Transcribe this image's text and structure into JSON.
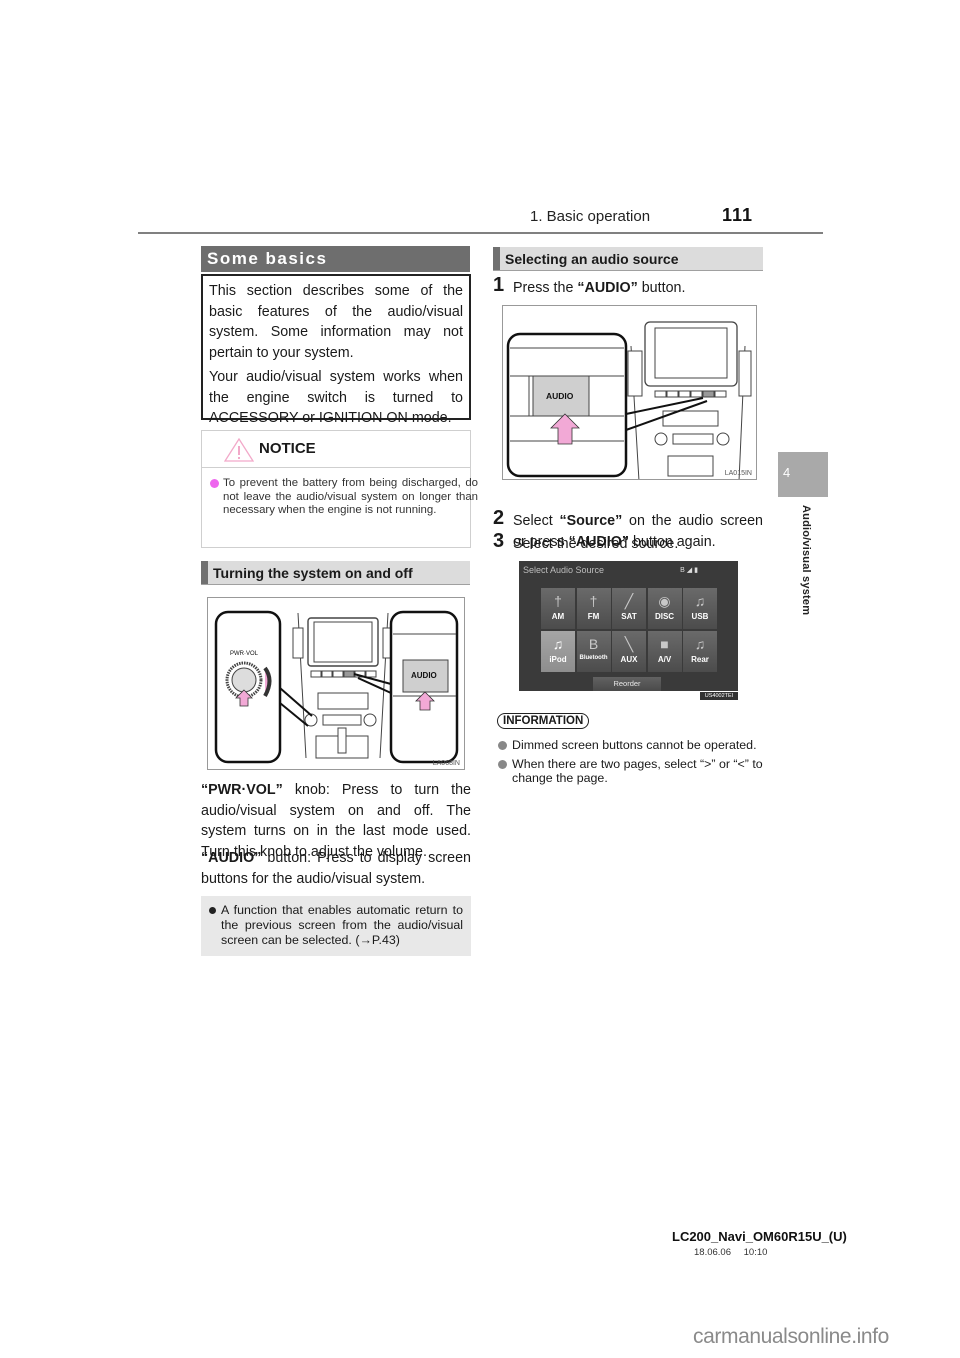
{
  "header": {
    "section": "1. Basic operation",
    "page_number": "111"
  },
  "side_tab": {
    "chapter_number": "4",
    "chapter_title": "Audio/visual system"
  },
  "some_basics": {
    "title": "Some basics",
    "paragraphs": [
      "This section describes some of the basic features of the audio/visual system. Some information may not pertain to your system.",
      "Your audio/visual system works when the engine switch is turned to ACCESSORY or IGNITION ON mode."
    ]
  },
  "notice": {
    "icon": "warning-triangle-icon",
    "title": "NOTICE",
    "items": [
      "To prevent the battery from being discharged, do not leave the audio/visual system on longer than necessary when the engine is not running."
    ]
  },
  "turning_on_off": {
    "title": "Turning the system on and off",
    "figure": {
      "knob_label": "PWR·VOL",
      "button_label": "AUDIO",
      "code": "LA068IN"
    },
    "pwr_vol": {
      "term": "“PWR·VOL”",
      "text": " knob: Press to turn the audio/visual system on and off. The system turns on in the last mode used. Turn this knob to adjust the volume."
    },
    "audio": {
      "term": "“AUDIO”",
      "text": " button: Press to display screen buttons for the audio/visual system."
    },
    "note": "A function that enables automatic return to the previous screen from the audio/visual screen can be selected. (→P.43)"
  },
  "selecting_source": {
    "title": "Selecting an audio source",
    "steps": [
      {
        "num": "1",
        "pre": "Press the ",
        "bold": "“AUDIO”",
        "post": " button."
      },
      {
        "num": "2",
        "pre": "Select ",
        "bold": "“Source”",
        "mid": " on the audio screen or press ",
        "bold2": "“AUDIO”",
        "post": " button again."
      },
      {
        "num": "3",
        "pre": "Select the desired source."
      }
    ],
    "figure1": {
      "button_label": "AUDIO",
      "code": "LA015IN"
    },
    "screen": {
      "title": "Select Audio Source",
      "status_icons": [
        "bluetooth-icon",
        "signal-icon",
        "battery-icon"
      ],
      "buttons": [
        {
          "label": "AM",
          "icon": "antenna-icon",
          "glyph": "†",
          "selected": false
        },
        {
          "label": "FM",
          "icon": "antenna-icon",
          "glyph": "†",
          "selected": false
        },
        {
          "label": "SAT",
          "icon": "satellite-icon",
          "glyph": "╱",
          "selected": false
        },
        {
          "label": "DISC",
          "icon": "disc-icon",
          "glyph": "◉",
          "selected": false
        },
        {
          "label": "USB",
          "icon": "music-note-icon",
          "glyph": "♫",
          "selected": false
        },
        {
          "label": "iPod",
          "icon": "music-note-icon",
          "glyph": "♫",
          "selected": true
        },
        {
          "label": "Bluetooth",
          "icon": "bluetooth-icon",
          "glyph": "Β",
          "selected": false
        },
        {
          "label": "AUX",
          "icon": "cable-icon",
          "glyph": "╲",
          "selected": false
        },
        {
          "label": "A/V",
          "icon": "video-camera-icon",
          "glyph": "■",
          "selected": false
        },
        {
          "label": "Rear",
          "icon": "music-note-icon",
          "glyph": "♫",
          "selected": false
        }
      ],
      "reorder_label": "Reorder",
      "code": "US4002TEI"
    }
  },
  "information": {
    "title": "INFORMATION",
    "items": [
      "Dimmed screen buttons cannot be operated.",
      "When there are two pages, select “>” or “<” to change the page."
    ]
  },
  "footer": {
    "document_id": "LC200_Navi_OM60R15U_(U)",
    "date": "18.06.06",
    "time": "10:10"
  },
  "watermark": "carmanualsonline.info",
  "colors": {
    "notice_bullet": "#ee66ee",
    "arrow_pink": "#f2a9d6",
    "section_dark": "#6e6e6e",
    "section_light": "#dcdcdc"
  }
}
